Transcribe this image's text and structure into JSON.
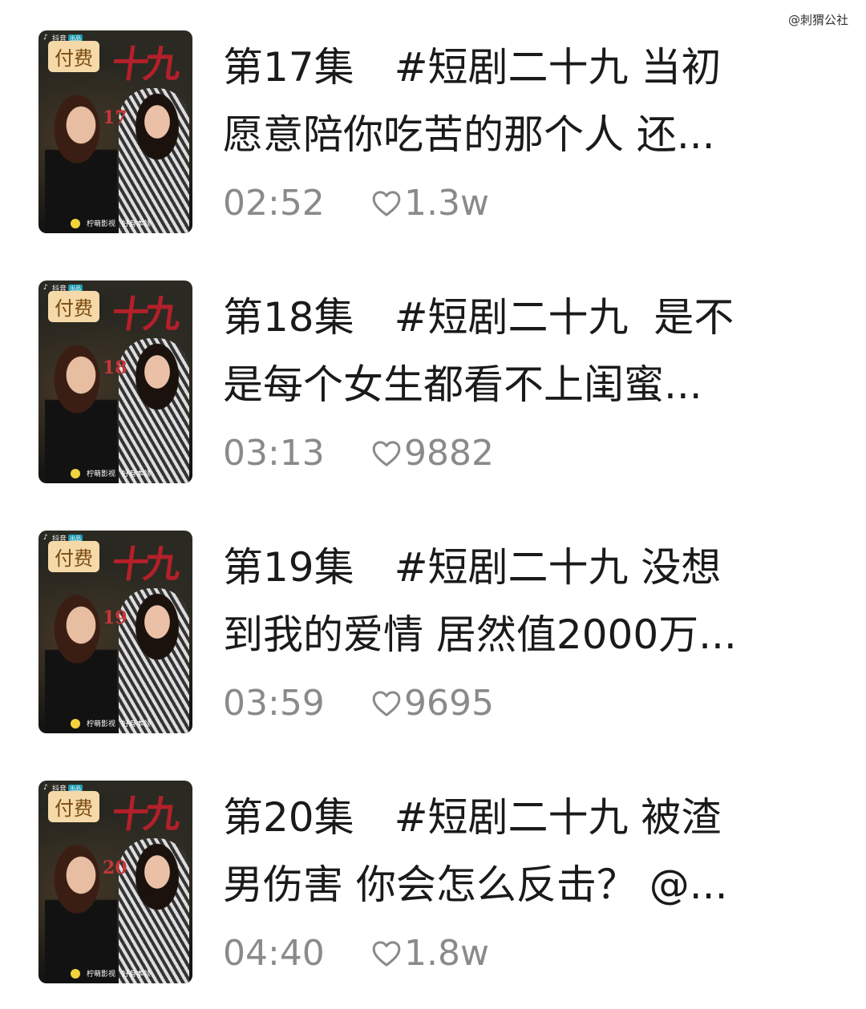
{
  "watermark": "@刺猬公社",
  "items": [
    {
      "badge": "付费",
      "platform": "抖音",
      "platform_tag": "出品",
      "thumb_number": "17",
      "thumb_title": "十九",
      "logo_left": "柠萌影视",
      "logo_right": "好有本领",
      "title_line1": "第17集　#短剧二十九 当初",
      "title_line2": "愿意陪你吃苦的那个人 还...",
      "duration": "02:52",
      "likes": "1.3w"
    },
    {
      "badge": "付费",
      "platform": "抖音",
      "platform_tag": "出品",
      "thumb_number": "18",
      "thumb_title": "十九",
      "logo_left": "柠萌影视",
      "logo_right": "好有本领",
      "title_line1": "第18集　#短剧二十九  是不",
      "title_line2": "是每个女生都看不上闺蜜...",
      "duration": "03:13",
      "likes": "9882"
    },
    {
      "badge": "付费",
      "platform": "抖音",
      "platform_tag": "出品",
      "thumb_number": "19",
      "thumb_title": "十九",
      "logo_left": "柠萌影视",
      "logo_right": "好有本领",
      "title_line1": "第19集　#短剧二十九 没想",
      "title_line2": "到我的爱情 居然值2000万...",
      "duration": "03:59",
      "likes": "9695"
    },
    {
      "badge": "付费",
      "platform": "抖音",
      "platform_tag": "出品",
      "thumb_number": "20",
      "thumb_title": "十九",
      "logo_left": "柠萌影视",
      "logo_right": "好有本领",
      "title_line1": "第20集　#短剧二十九 被渣",
      "title_line2": "男伤害 你会怎么反击？ @...",
      "duration": "04:40",
      "likes": "1.8w"
    }
  ],
  "colors": {
    "text": "#1a1a1a",
    "meta": "#8a8a8a",
    "badge_bg": "#f5d9a8",
    "badge_text": "#7a4b13",
    "thumb_title": "#b3202a"
  },
  "icons": {
    "like": "heart-icon",
    "platform": "douyin-note-icon"
  }
}
